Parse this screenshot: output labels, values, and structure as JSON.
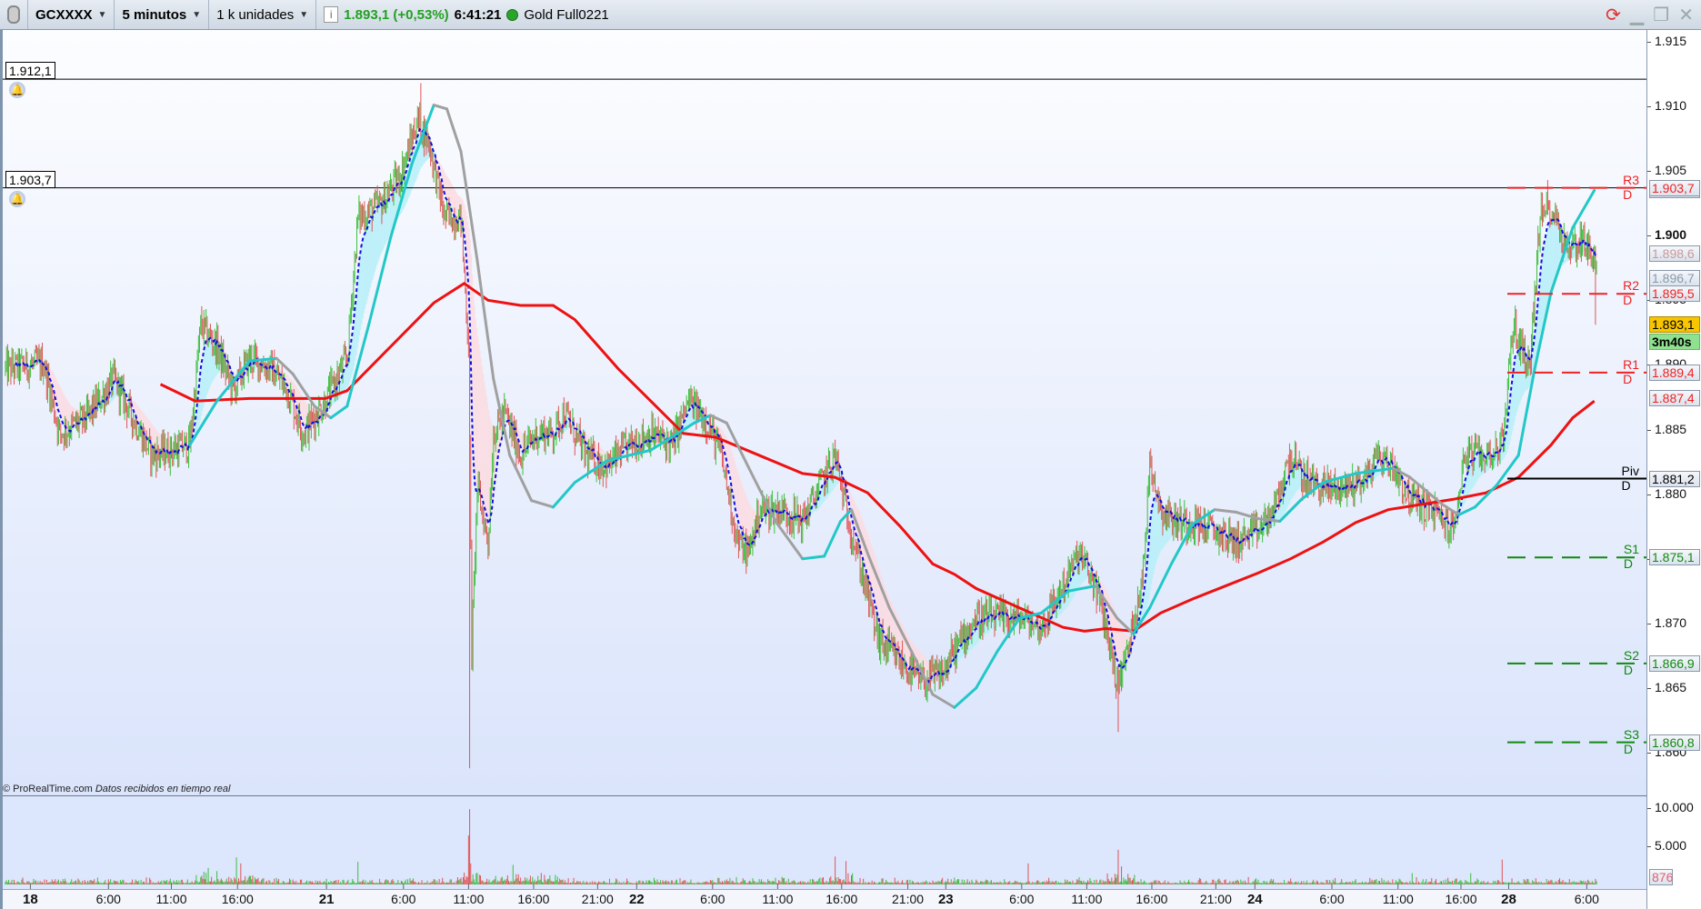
{
  "header": {
    "instrument": "GCXXXX",
    "timeframe": "5 minutos",
    "units": "1 k unidades",
    "last_price": "1.893,1 (+0,53%)",
    "clock": "6:41:21",
    "feed": "Gold Full0221"
  },
  "credit": {
    "brand": "© ProRealTime.com",
    "text": "Datos recibidos en tiempo real"
  },
  "alarms": [
    {
      "label": "1.912,1",
      "price": 1912.1
    },
    {
      "label": "1.903,7",
      "price": 1903.7
    }
  ],
  "colors": {
    "up": "#3cc03c",
    "down": "#e05555",
    "ma_long": "#ee1111",
    "ma_up": "#22c8c8",
    "ma_down": "#a0a0a0",
    "ema": "#1010dd",
    "resist": "#ee2222",
    "support": "#118811",
    "pivot": "#000000"
  },
  "chart_data": {
    "type": "candlestick",
    "title": "GCXXXX 5 minutos",
    "ylim": [
      1857,
      1917
    ],
    "y_ticks": [
      {
        "v": 1915,
        "label": "1.915"
      },
      {
        "v": 1910,
        "label": "1.910"
      },
      {
        "v": 1905,
        "label": "1.905"
      },
      {
        "v": 1900,
        "label": "1.900"
      },
      {
        "v": 1895,
        "label": "1.895"
      },
      {
        "v": 1890,
        "label": "1.890"
      },
      {
        "v": 1885,
        "label": "1.885"
      },
      {
        "v": 1880,
        "label": "1.880"
      },
      {
        "v": 1875,
        "label": "1.875"
      },
      {
        "v": 1870,
        "label": "1.870"
      },
      {
        "v": 1865,
        "label": "1.865"
      },
      {
        "v": 1860,
        "label": "1.860"
      }
    ],
    "x_labels": [
      {
        "bar": 28,
        "label": "18",
        "day": true
      },
      {
        "bar": 100,
        "label": "6:00"
      },
      {
        "bar": 158,
        "label": "11:00"
      },
      {
        "bar": 219,
        "label": "16:00"
      },
      {
        "bar": 301,
        "label": "21",
        "day": true
      },
      {
        "bar": 372,
        "label": "6:00"
      },
      {
        "bar": 432,
        "label": "11:00"
      },
      {
        "bar": 492,
        "label": "16:00"
      },
      {
        "bar": 551,
        "label": "21:00"
      },
      {
        "bar": 587,
        "label": "22",
        "day": true
      },
      {
        "bar": 657,
        "label": "6:00"
      },
      {
        "bar": 717,
        "label": "11:00"
      },
      {
        "bar": 776,
        "label": "16:00"
      },
      {
        "bar": 837,
        "label": "21:00"
      },
      {
        "bar": 872,
        "label": "23",
        "day": true
      },
      {
        "bar": 942,
        "label": "6:00"
      },
      {
        "bar": 1002,
        "label": "11:00"
      },
      {
        "bar": 1062,
        "label": "16:00"
      },
      {
        "bar": 1121,
        "label": "21:00"
      },
      {
        "bar": 1157,
        "label": "24",
        "day": true
      },
      {
        "bar": 1228,
        "label": "6:00"
      },
      {
        "bar": 1289,
        "label": "11:00"
      },
      {
        "bar": 1347,
        "label": "16:00"
      },
      {
        "bar": 1391,
        "label": "28",
        "day": true
      },
      {
        "bar": 1463,
        "label": "6:00"
      }
    ],
    "price_path": [
      [
        5,
        1889.7
      ],
      [
        40,
        1890.1
      ],
      [
        55,
        1884.7
      ],
      [
        80,
        1885.9
      ],
      [
        105,
        1888.9
      ],
      [
        120,
        1886.3
      ],
      [
        140,
        1883.0
      ],
      [
        175,
        1883.8
      ],
      [
        185,
        1893.1
      ],
      [
        200,
        1891.4
      ],
      [
        215,
        1888.0
      ],
      [
        230,
        1890.5
      ],
      [
        250,
        1889.7
      ],
      [
        265,
        1888.0
      ],
      [
        280,
        1884.7
      ],
      [
        300,
        1887.2
      ],
      [
        320,
        1890.5
      ],
      [
        330,
        1901.4
      ],
      [
        350,
        1902.3
      ],
      [
        370,
        1904.8
      ],
      [
        385,
        1909.0
      ],
      [
        395,
        1907.3
      ],
      [
        410,
        1901.4
      ],
      [
        425,
        1901.4
      ],
      [
        432,
        1891.4
      ],
      [
        435,
        1867.9
      ],
      [
        440,
        1880.5
      ],
      [
        450,
        1876.3
      ],
      [
        455,
        1884.7
      ],
      [
        465,
        1886.3
      ],
      [
        480,
        1883.0
      ],
      [
        495,
        1884.7
      ],
      [
        510,
        1884.7
      ],
      [
        520,
        1886.3
      ],
      [
        540,
        1883.0
      ],
      [
        560,
        1882.1
      ],
      [
        580,
        1883.8
      ],
      [
        600,
        1884.7
      ],
      [
        620,
        1883.8
      ],
      [
        635,
        1887.2
      ],
      [
        650,
        1885.9
      ],
      [
        665,
        1883.0
      ],
      [
        680,
        1876.3
      ],
      [
        690,
        1875.4
      ],
      [
        700,
        1878.8
      ],
      [
        720,
        1878.8
      ],
      [
        740,
        1877.9
      ],
      [
        755,
        1880.5
      ],
      [
        770,
        1883.0
      ],
      [
        780,
        1878.8
      ],
      [
        795,
        1873.8
      ],
      [
        810,
        1868.7
      ],
      [
        830,
        1867.0
      ],
      [
        850,
        1865.4
      ],
      [
        870,
        1866.2
      ],
      [
        880,
        1867.9
      ],
      [
        900,
        1870.4
      ],
      [
        920,
        1870.4
      ],
      [
        940,
        1870.4
      ],
      [
        960,
        1869.6
      ],
      [
        980,
        1872.9
      ],
      [
        995,
        1875.4
      ],
      [
        1010,
        1872.9
      ],
      [
        1020,
        1869.6
      ],
      [
        1030,
        1865.4
      ],
      [
        1040,
        1867.9
      ],
      [
        1055,
        1874.6
      ],
      [
        1060,
        1883.0
      ],
      [
        1070,
        1878.8
      ],
      [
        1085,
        1877.9
      ],
      [
        1100,
        1877.9
      ],
      [
        1120,
        1877.1
      ],
      [
        1140,
        1876.3
      ],
      [
        1160,
        1877.1
      ],
      [
        1175,
        1878.8
      ],
      [
        1190,
        1883.0
      ],
      [
        1200,
        1881.3
      ],
      [
        1220,
        1880.5
      ],
      [
        1240,
        1880.5
      ],
      [
        1260,
        1881.3
      ],
      [
        1270,
        1883.0
      ],
      [
        1285,
        1882.1
      ],
      [
        1300,
        1879.6
      ],
      [
        1320,
        1878.8
      ],
      [
        1340,
        1877.1
      ],
      [
        1350,
        1883.0
      ],
      [
        1370,
        1883.0
      ],
      [
        1385,
        1883.8
      ],
      [
        1395,
        1893.1
      ],
      [
        1410,
        1889.7
      ],
      [
        1420,
        1901.4
      ],
      [
        1430,
        1902.3
      ],
      [
        1445,
        1898.9
      ],
      [
        1460,
        1899.8
      ],
      [
        1470,
        1898.1
      ]
    ],
    "extremes": [
      {
        "bar": 388,
        "high": 1911.8
      },
      {
        "bar": 433,
        "low": 1858.8
      },
      {
        "bar": 1031,
        "low": 1861.6
      },
      {
        "bar": 1427,
        "high": 1904.3
      },
      {
        "bar": 1471,
        "low": 1893.1
      }
    ],
    "ma_long": [
      [
        148,
        1888.5
      ],
      [
        180,
        1887.2
      ],
      [
        230,
        1887.4
      ],
      [
        300,
        1887.4
      ],
      [
        320,
        1888.0
      ],
      [
        360,
        1891.4
      ],
      [
        400,
        1894.8
      ],
      [
        428,
        1896.3
      ],
      [
        450,
        1895.0
      ],
      [
        480,
        1894.6
      ],
      [
        510,
        1894.6
      ],
      [
        530,
        1893.5
      ],
      [
        570,
        1889.7
      ],
      [
        600,
        1887.2
      ],
      [
        630,
        1884.7
      ],
      [
        660,
        1884.4
      ],
      [
        700,
        1883.0
      ],
      [
        740,
        1881.6
      ],
      [
        770,
        1881.3
      ],
      [
        800,
        1880.1
      ],
      [
        830,
        1877.5
      ],
      [
        860,
        1874.6
      ],
      [
        880,
        1873.8
      ],
      [
        900,
        1872.7
      ],
      [
        940,
        1871.2
      ],
      [
        980,
        1869.7
      ],
      [
        1000,
        1869.4
      ],
      [
        1020,
        1869.6
      ],
      [
        1045,
        1869.4
      ],
      [
        1070,
        1870.8
      ],
      [
        1100,
        1871.9
      ],
      [
        1130,
        1872.9
      ],
      [
        1160,
        1873.9
      ],
      [
        1190,
        1875.0
      ],
      [
        1220,
        1876.3
      ],
      [
        1250,
        1877.8
      ],
      [
        1280,
        1878.8
      ],
      [
        1310,
        1879.2
      ],
      [
        1340,
        1879.6
      ],
      [
        1370,
        1880.1
      ],
      [
        1400,
        1881.3
      ],
      [
        1430,
        1883.8
      ],
      [
        1450,
        1885.9
      ],
      [
        1470,
        1887.2
      ]
    ],
    "ma_trend": [
      [
        175,
        1883.8
      ],
      [
        200,
        1887.2
      ],
      [
        230,
        1890.3
      ],
      [
        255,
        1890.5
      ],
      [
        270,
        1889.3
      ],
      [
        290,
        1886.8
      ],
      [
        305,
        1885.9
      ],
      [
        320,
        1886.8
      ],
      [
        340,
        1893.1
      ],
      [
        360,
        1899.8
      ],
      [
        380,
        1905.6
      ],
      [
        400,
        1910.1
      ],
      [
        412,
        1909.8
      ],
      [
        425,
        1906.5
      ],
      [
        440,
        1898.1
      ],
      [
        455,
        1888.9
      ],
      [
        470,
        1883.0
      ],
      [
        490,
        1879.5
      ],
      [
        510,
        1879.0
      ],
      [
        530,
        1880.9
      ],
      [
        560,
        1882.6
      ],
      [
        600,
        1883.4
      ],
      [
        640,
        1885.5
      ],
      [
        655,
        1886.1
      ],
      [
        670,
        1885.5
      ],
      [
        690,
        1882.1
      ],
      [
        715,
        1877.9
      ],
      [
        740,
        1875.0
      ],
      [
        760,
        1875.2
      ],
      [
        775,
        1877.9
      ],
      [
        785,
        1878.8
      ],
      [
        800,
        1875.4
      ],
      [
        820,
        1871.2
      ],
      [
        840,
        1867.9
      ],
      [
        860,
        1864.5
      ],
      [
        880,
        1863.5
      ],
      [
        900,
        1865.0
      ],
      [
        920,
        1867.9
      ],
      [
        940,
        1870.4
      ],
      [
        960,
        1870.8
      ],
      [
        985,
        1872.5
      ],
      [
        1010,
        1872.9
      ],
      [
        1030,
        1870.4
      ],
      [
        1045,
        1869.2
      ],
      [
        1060,
        1871.2
      ],
      [
        1080,
        1874.6
      ],
      [
        1100,
        1877.7
      ],
      [
        1120,
        1878.8
      ],
      [
        1140,
        1878.6
      ],
      [
        1160,
        1878.1
      ],
      [
        1180,
        1877.9
      ],
      [
        1200,
        1879.6
      ],
      [
        1220,
        1880.9
      ],
      [
        1250,
        1881.6
      ],
      [
        1285,
        1882.0
      ],
      [
        1300,
        1881.3
      ],
      [
        1330,
        1879.2
      ],
      [
        1345,
        1878.4
      ],
      [
        1360,
        1879.0
      ],
      [
        1380,
        1880.7
      ],
      [
        1400,
        1883.0
      ],
      [
        1415,
        1889.7
      ],
      [
        1430,
        1895.6
      ],
      [
        1450,
        1900.6
      ],
      [
        1470,
        1903.5
      ]
    ],
    "pivots": [
      {
        "name": "R3 D",
        "value": 1903.7,
        "label": "1.903,7",
        "kind": "resist"
      },
      {
        "name": "R2 D",
        "value": 1895.5,
        "label": "1.895,5",
        "kind": "resist"
      },
      {
        "name": "R1 D",
        "value": 1889.4,
        "label": "1.889,4",
        "kind": "resist"
      },
      {
        "name": "Piv D",
        "value": 1881.2,
        "label": "1.881,2",
        "kind": "pivot"
      },
      {
        "name": "S1 D",
        "value": 1875.1,
        "label": "1.875,1",
        "kind": "support"
      },
      {
        "name": "S2 D",
        "value": 1866.9,
        "label": "1.866,9",
        "kind": "support"
      },
      {
        "name": "S3 D",
        "value": 1860.8,
        "label": "1.860,8",
        "kind": "support"
      }
    ],
    "axis_badges": [
      {
        "label": "1.903,5",
        "value": 1903.5,
        "color": "#22aacc"
      },
      {
        "label": "1.898,6",
        "value": 1898.6,
        "color": "#c89a9a"
      },
      {
        "label": "1.896,7",
        "value": 1896.7,
        "color": "#8899aa"
      },
      {
        "label": "1.887,4",
        "value": 1887.4,
        "color": "#ee2222"
      }
    ],
    "current": {
      "label": "1.893,1",
      "value": 1893.1,
      "countdown": "3m40s"
    },
    "volume": {
      "ticks": [
        {
          "v": 10000,
          "label": "10.000"
        },
        {
          "v": 5000,
          "label": "5.000"
        }
      ],
      "current_label": "876",
      "current": 876,
      "ymax": 11000,
      "spikes": [
        [
          192,
          2200
        ],
        [
          218,
          3600
        ],
        [
          222,
          2800
        ],
        [
          330,
          3000
        ],
        [
          432,
          6500
        ],
        [
          433,
          10000
        ],
        [
          434,
          2800
        ],
        [
          473,
          2600
        ],
        [
          770,
          3700
        ],
        [
          780,
          3100
        ],
        [
          948,
          2800
        ],
        [
          1031,
          4600
        ],
        [
          1034,
          2400
        ],
        [
          1302,
          1500
        ],
        [
          1356,
          1500
        ],
        [
          1385,
          3300
        ]
      ]
    }
  }
}
